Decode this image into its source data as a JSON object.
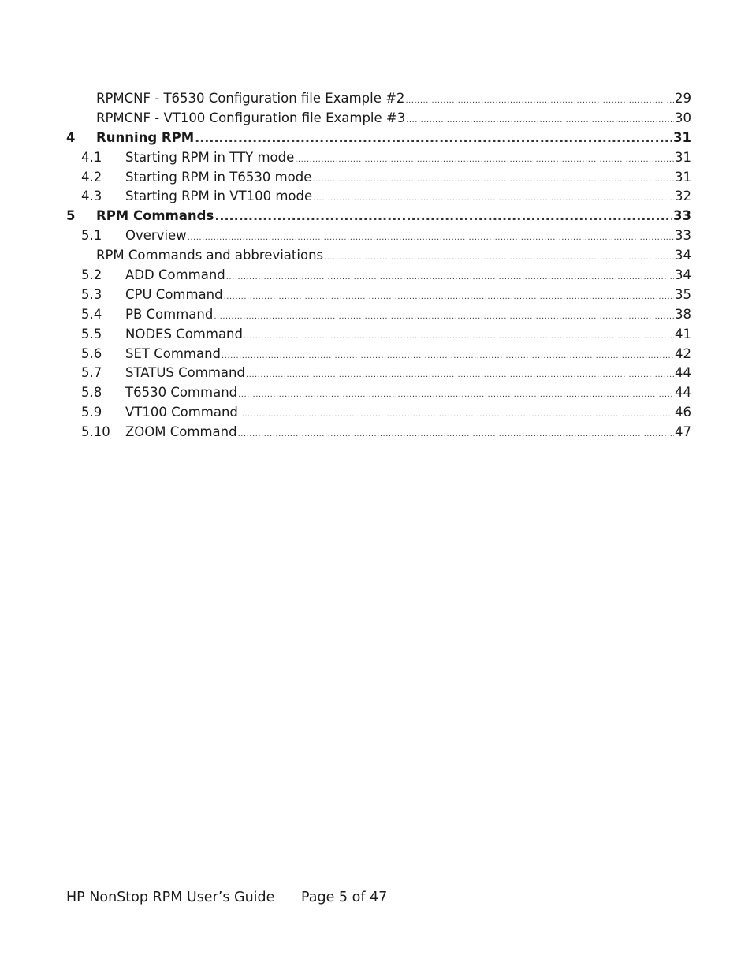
{
  "toc": {
    "entries": [
      {
        "level": 3,
        "number": "",
        "title": "RPMCNF - T6530 Configuration file Example #2",
        "page": "29"
      },
      {
        "level": 3,
        "number": "",
        "title": "RPMCNF - VT100 Configuration file Example #3",
        "page": "30"
      },
      {
        "level": 1,
        "number": "4",
        "title": "Running RPM",
        "page": "31"
      },
      {
        "level": 2,
        "number": "4.1",
        "title": "Starting RPM in TTY mode",
        "page": "31"
      },
      {
        "level": 2,
        "number": "4.2",
        "title": "Starting RPM in T6530 mode",
        "page": "31"
      },
      {
        "level": 2,
        "number": "4.3",
        "title": "Starting RPM in VT100 mode",
        "page": "32"
      },
      {
        "level": 1,
        "number": "5",
        "title": "RPM Commands",
        "page": "33"
      },
      {
        "level": 2,
        "number": "5.1",
        "title": "Overview",
        "page": "33"
      },
      {
        "level": 3,
        "number": "",
        "title": "RPM Commands and abbreviations",
        "page": "34"
      },
      {
        "level": 2,
        "number": "5.2",
        "title": "ADD Command",
        "page": "34"
      },
      {
        "level": 2,
        "number": "5.3",
        "title": "CPU Command",
        "page": "35"
      },
      {
        "level": 2,
        "number": "5.4",
        "title": "PB Command",
        "page": "38"
      },
      {
        "level": 2,
        "number": "5.5",
        "title": "NODES Command",
        "page": "41"
      },
      {
        "level": 2,
        "number": "5.6",
        "title": "SET Command",
        "page": "42"
      },
      {
        "level": 2,
        "number": "5.7",
        "title": "STATUS Command",
        "page": "44"
      },
      {
        "level": 2,
        "number": "5.8",
        "title": "T6530 Command",
        "page": "44"
      },
      {
        "level": 2,
        "number": "5.9",
        "title": "VT100 Command",
        "page": "46"
      },
      {
        "level": 2,
        "number": "5.10",
        "title": "ZOOM Command",
        "page": "47"
      }
    ]
  },
  "footer": {
    "doc_title": "HP NonStop RPM User’s Guide",
    "page_label": "Page 5 of 47"
  }
}
